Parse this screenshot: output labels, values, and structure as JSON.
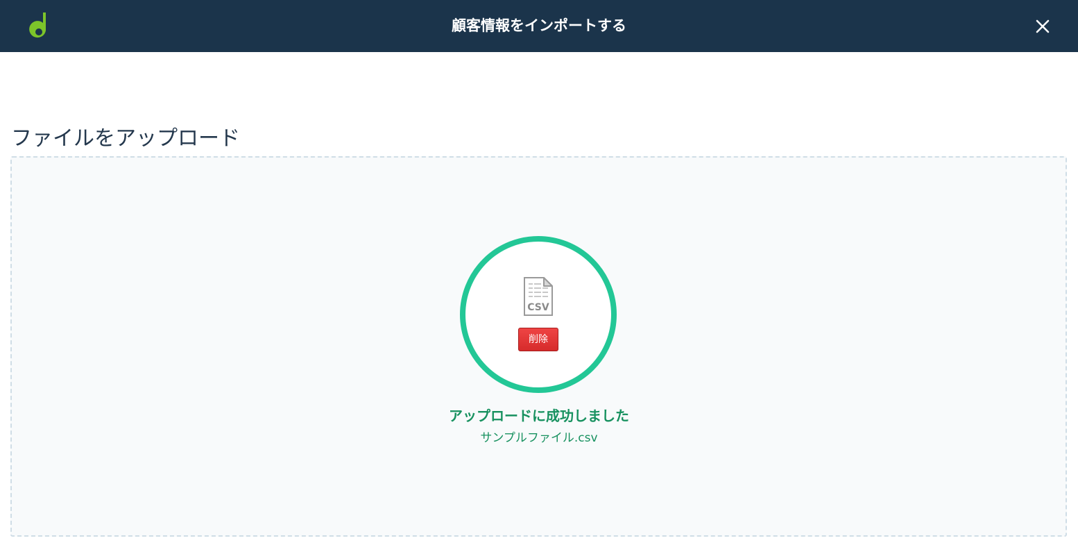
{
  "header": {
    "title": "顧客情報をインポートする",
    "logo_icon": "brand-logo",
    "close_icon": "close-icon"
  },
  "upload": {
    "section_title": "ファイルをアップロード",
    "file_icon_text": "CSV",
    "delete_label": "削除",
    "success_message": "アップロードに成功しました",
    "file_name": "サンプルファイル.csv",
    "status_color": "#23c796",
    "delete_color": "#e03535"
  }
}
